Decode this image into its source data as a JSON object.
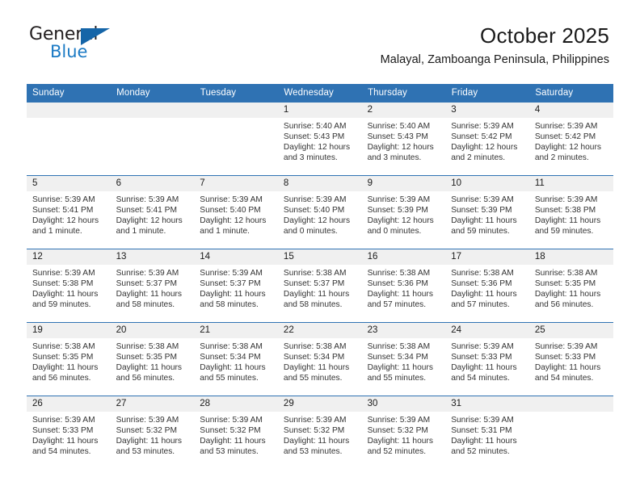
{
  "brand": {
    "name_top": "General",
    "name_bottom": "Blue",
    "accent_color": "#1b7ac4",
    "triangle_color": "#1565a8"
  },
  "header": {
    "title": "October 2025",
    "subtitle": "Malayal, Zamboanga Peninsula, Philippines",
    "header_bg": "#2f72b3",
    "daynum_bg": "#f0f0f0"
  },
  "weekdays": [
    "Sunday",
    "Monday",
    "Tuesday",
    "Wednesday",
    "Thursday",
    "Friday",
    "Saturday"
  ],
  "weeks": [
    [
      {
        "day": "",
        "lines": []
      },
      {
        "day": "",
        "lines": []
      },
      {
        "day": "",
        "lines": []
      },
      {
        "day": "1",
        "lines": [
          "Sunrise: 5:40 AM",
          "Sunset: 5:43 PM",
          "Daylight: 12 hours",
          "and 3 minutes."
        ]
      },
      {
        "day": "2",
        "lines": [
          "Sunrise: 5:40 AM",
          "Sunset: 5:43 PM",
          "Daylight: 12 hours",
          "and 3 minutes."
        ]
      },
      {
        "day": "3",
        "lines": [
          "Sunrise: 5:39 AM",
          "Sunset: 5:42 PM",
          "Daylight: 12 hours",
          "and 2 minutes."
        ]
      },
      {
        "day": "4",
        "lines": [
          "Sunrise: 5:39 AM",
          "Sunset: 5:42 PM",
          "Daylight: 12 hours",
          "and 2 minutes."
        ]
      }
    ],
    [
      {
        "day": "5",
        "lines": [
          "Sunrise: 5:39 AM",
          "Sunset: 5:41 PM",
          "Daylight: 12 hours",
          "and 1 minute."
        ]
      },
      {
        "day": "6",
        "lines": [
          "Sunrise: 5:39 AM",
          "Sunset: 5:41 PM",
          "Daylight: 12 hours",
          "and 1 minute."
        ]
      },
      {
        "day": "7",
        "lines": [
          "Sunrise: 5:39 AM",
          "Sunset: 5:40 PM",
          "Daylight: 12 hours",
          "and 1 minute."
        ]
      },
      {
        "day": "8",
        "lines": [
          "Sunrise: 5:39 AM",
          "Sunset: 5:40 PM",
          "Daylight: 12 hours",
          "and 0 minutes."
        ]
      },
      {
        "day": "9",
        "lines": [
          "Sunrise: 5:39 AM",
          "Sunset: 5:39 PM",
          "Daylight: 12 hours",
          "and 0 minutes."
        ]
      },
      {
        "day": "10",
        "lines": [
          "Sunrise: 5:39 AM",
          "Sunset: 5:39 PM",
          "Daylight: 11 hours",
          "and 59 minutes."
        ]
      },
      {
        "day": "11",
        "lines": [
          "Sunrise: 5:39 AM",
          "Sunset: 5:38 PM",
          "Daylight: 11 hours",
          "and 59 minutes."
        ]
      }
    ],
    [
      {
        "day": "12",
        "lines": [
          "Sunrise: 5:39 AM",
          "Sunset: 5:38 PM",
          "Daylight: 11 hours",
          "and 59 minutes."
        ]
      },
      {
        "day": "13",
        "lines": [
          "Sunrise: 5:39 AM",
          "Sunset: 5:37 PM",
          "Daylight: 11 hours",
          "and 58 minutes."
        ]
      },
      {
        "day": "14",
        "lines": [
          "Sunrise: 5:39 AM",
          "Sunset: 5:37 PM",
          "Daylight: 11 hours",
          "and 58 minutes."
        ]
      },
      {
        "day": "15",
        "lines": [
          "Sunrise: 5:38 AM",
          "Sunset: 5:37 PM",
          "Daylight: 11 hours",
          "and 58 minutes."
        ]
      },
      {
        "day": "16",
        "lines": [
          "Sunrise: 5:38 AM",
          "Sunset: 5:36 PM",
          "Daylight: 11 hours",
          "and 57 minutes."
        ]
      },
      {
        "day": "17",
        "lines": [
          "Sunrise: 5:38 AM",
          "Sunset: 5:36 PM",
          "Daylight: 11 hours",
          "and 57 minutes."
        ]
      },
      {
        "day": "18",
        "lines": [
          "Sunrise: 5:38 AM",
          "Sunset: 5:35 PM",
          "Daylight: 11 hours",
          "and 56 minutes."
        ]
      }
    ],
    [
      {
        "day": "19",
        "lines": [
          "Sunrise: 5:38 AM",
          "Sunset: 5:35 PM",
          "Daylight: 11 hours",
          "and 56 minutes."
        ]
      },
      {
        "day": "20",
        "lines": [
          "Sunrise: 5:38 AM",
          "Sunset: 5:35 PM",
          "Daylight: 11 hours",
          "and 56 minutes."
        ]
      },
      {
        "day": "21",
        "lines": [
          "Sunrise: 5:38 AM",
          "Sunset: 5:34 PM",
          "Daylight: 11 hours",
          "and 55 minutes."
        ]
      },
      {
        "day": "22",
        "lines": [
          "Sunrise: 5:38 AM",
          "Sunset: 5:34 PM",
          "Daylight: 11 hours",
          "and 55 minutes."
        ]
      },
      {
        "day": "23",
        "lines": [
          "Sunrise: 5:38 AM",
          "Sunset: 5:34 PM",
          "Daylight: 11 hours",
          "and 55 minutes."
        ]
      },
      {
        "day": "24",
        "lines": [
          "Sunrise: 5:39 AM",
          "Sunset: 5:33 PM",
          "Daylight: 11 hours",
          "and 54 minutes."
        ]
      },
      {
        "day": "25",
        "lines": [
          "Sunrise: 5:39 AM",
          "Sunset: 5:33 PM",
          "Daylight: 11 hours",
          "and 54 minutes."
        ]
      }
    ],
    [
      {
        "day": "26",
        "lines": [
          "Sunrise: 5:39 AM",
          "Sunset: 5:33 PM",
          "Daylight: 11 hours",
          "and 54 minutes."
        ]
      },
      {
        "day": "27",
        "lines": [
          "Sunrise: 5:39 AM",
          "Sunset: 5:32 PM",
          "Daylight: 11 hours",
          "and 53 minutes."
        ]
      },
      {
        "day": "28",
        "lines": [
          "Sunrise: 5:39 AM",
          "Sunset: 5:32 PM",
          "Daylight: 11 hours",
          "and 53 minutes."
        ]
      },
      {
        "day": "29",
        "lines": [
          "Sunrise: 5:39 AM",
          "Sunset: 5:32 PM",
          "Daylight: 11 hours",
          "and 53 minutes."
        ]
      },
      {
        "day": "30",
        "lines": [
          "Sunrise: 5:39 AM",
          "Sunset: 5:32 PM",
          "Daylight: 11 hours",
          "and 52 minutes."
        ]
      },
      {
        "day": "31",
        "lines": [
          "Sunrise: 5:39 AM",
          "Sunset: 5:31 PM",
          "Daylight: 11 hours",
          "and 52 minutes."
        ]
      },
      {
        "day": "",
        "lines": []
      }
    ]
  ]
}
